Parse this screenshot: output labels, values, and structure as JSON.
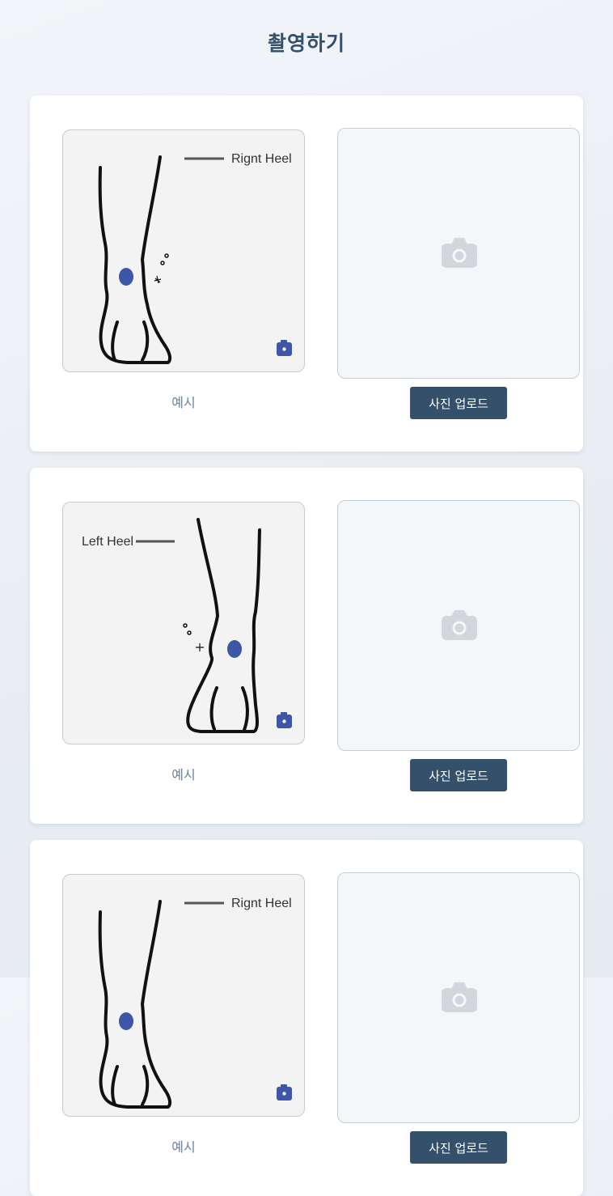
{
  "page": {
    "title": "촬영하기"
  },
  "cards": [
    {
      "heel_label": "Rignt Heel",
      "caption": "예시",
      "upload_label": "사진 업로드"
    },
    {
      "heel_label": "Left Heel",
      "caption": "예시",
      "upload_label": "사진 업로드"
    },
    {
      "heel_label": "Rignt Heel",
      "caption": "예시",
      "upload_label": "사진 업로드"
    }
  ],
  "colors": {
    "accent": "#34506b",
    "dot": "#3d56a6",
    "caption": "#6c8297"
  },
  "icons": {
    "upload_placeholder": "camera-icon",
    "example_badge": "camera-badge-icon"
  }
}
